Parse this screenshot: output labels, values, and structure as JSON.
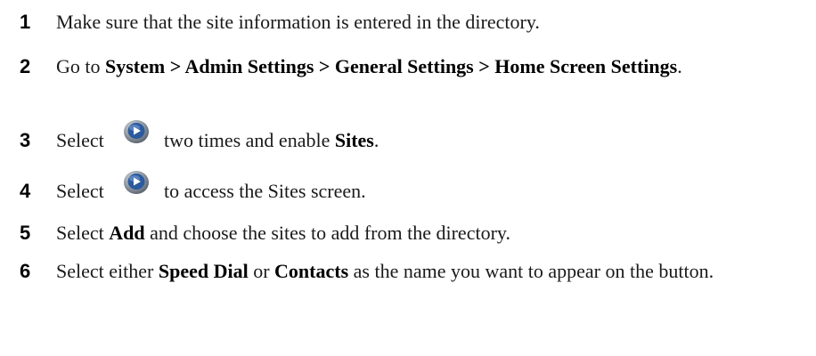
{
  "steps": [
    {
      "number": "1",
      "text": "Make sure that the site information is entered in the directory."
    },
    {
      "number": "2",
      "prefix": "Go to ",
      "bold": "System > Admin Settings > General Settings > Home Screen Settings",
      "suffix": "."
    },
    {
      "number": "3",
      "prefix": "Select",
      "icon": "play-arrow-button-icon",
      "middle": "two times and enable ",
      "bold": "Sites",
      "suffix": "."
    },
    {
      "number": "4",
      "prefix": "Select",
      "icon": "play-arrow-button-icon",
      "middle": "to access the Sites screen."
    },
    {
      "number": "5",
      "prefix": "Select ",
      "bold": "Add",
      "suffix": " and choose the sites to add from the directory."
    },
    {
      "number": "6",
      "prefix": "Select either ",
      "bold1": "Speed Dial",
      "mid": " or ",
      "bold2": "Contacts",
      "suffix": " as the name you want to appear on the button."
    }
  ],
  "colors": {
    "text": "#1a1a1a",
    "icon_blue": "#2b5a9e",
    "icon_gray": "#8a8f96"
  }
}
